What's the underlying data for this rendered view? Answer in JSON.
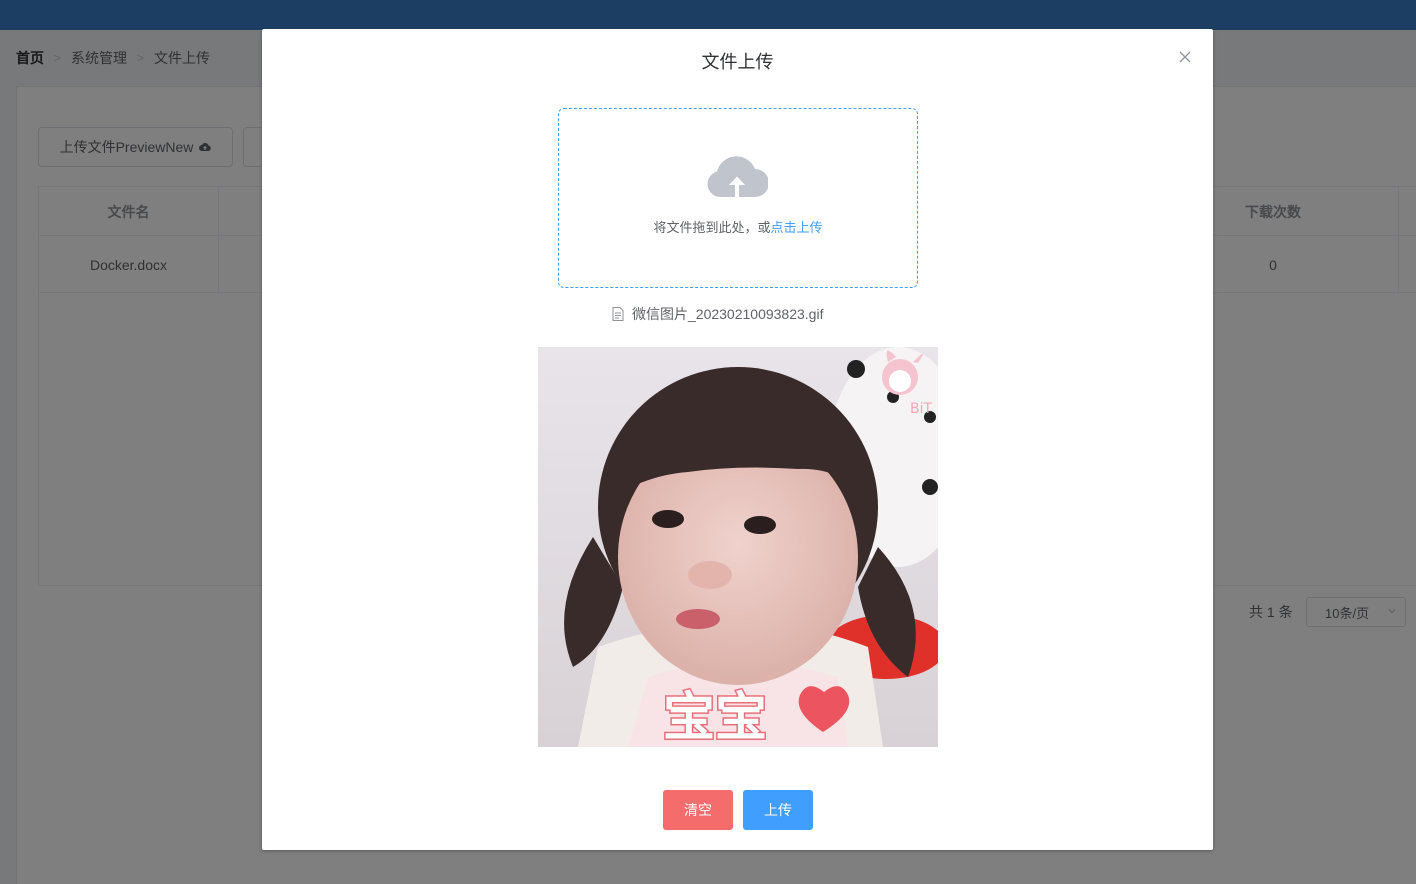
{
  "breadcrumb": [
    "首页",
    "系统管理",
    "文件上传"
  ],
  "toolbar": {
    "upload_preview_label": "上传文件PreviewNew"
  },
  "table": {
    "headers": [
      "文件名",
      "下载次数"
    ],
    "rows": [
      {
        "filename": "Docker.docx",
        "downloads": "0"
      }
    ]
  },
  "pager": {
    "total": "共 1 条",
    "size": "10条/页"
  },
  "dialog": {
    "title": "文件上传",
    "dropzone_hint": "将文件拖到此处，或",
    "dropzone_link": "点击上传",
    "file_name": "微信图片_20230210093823.gif",
    "preview_caption": "宝宝",
    "preview_watermark": "BiT",
    "clear_label": "清空",
    "upload_label": "上传"
  },
  "colors": {
    "primary": "#409eff",
    "danger": "#f56c6c",
    "topbar": "#3a7cc6"
  }
}
